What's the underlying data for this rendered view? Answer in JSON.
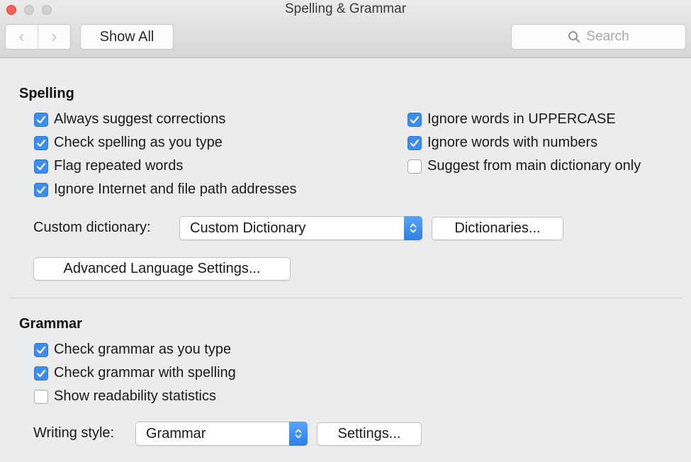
{
  "window": {
    "title": "Spelling & Grammar"
  },
  "toolbar": {
    "back_glyph": "‹",
    "forward_glyph": "›",
    "show_all_label": "Show All",
    "search_placeholder": "Search"
  },
  "spelling": {
    "title": "Spelling",
    "left_options": [
      {
        "label": "Always suggest corrections",
        "checked": true
      },
      {
        "label": "Check spelling as you type",
        "checked": true
      },
      {
        "label": "Flag repeated words",
        "checked": true
      },
      {
        "label": "Ignore Internet and file path addresses",
        "checked": true
      }
    ],
    "right_options": [
      {
        "label": "Ignore words in UPPERCASE",
        "checked": true
      },
      {
        "label": "Ignore words with numbers",
        "checked": true
      },
      {
        "label": "Suggest from main dictionary only",
        "checked": false
      }
    ],
    "custom_dictionary_label": "Custom dictionary:",
    "custom_dictionary_value": "Custom Dictionary",
    "dictionaries_button": "Dictionaries...",
    "advanced_button": "Advanced Language Settings..."
  },
  "grammar": {
    "title": "Grammar",
    "options": [
      {
        "label": "Check grammar as you type",
        "checked": true
      },
      {
        "label": "Check grammar with spelling",
        "checked": true
      },
      {
        "label": "Show readability statistics",
        "checked": false
      }
    ],
    "writing_style_label": "Writing style:",
    "writing_style_value": "Grammar",
    "settings_button": "Settings..."
  },
  "colors": {
    "checkbox_on": "#3d8cf2",
    "close_button": "#ff5f57",
    "stepper": "#2f7fe8"
  }
}
